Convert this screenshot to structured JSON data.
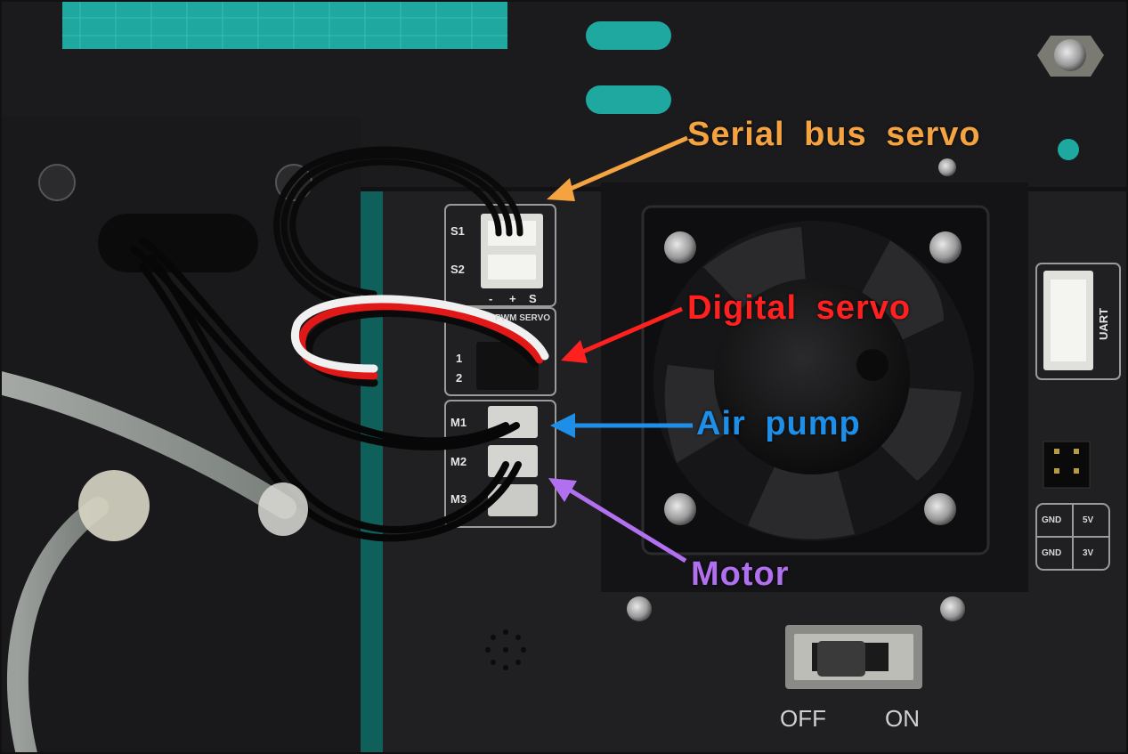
{
  "callouts": {
    "serial_bus_servo": {
      "text": "Serial bus servo",
      "color": "#F5A340"
    },
    "digital_servo": {
      "text": "Digital servo",
      "color": "#FF2020"
    },
    "air_pump": {
      "text": "Air pump",
      "color": "#1E8FE8"
    },
    "motor": {
      "text": "Motor",
      "color": "#B070F0"
    }
  },
  "board_labels": {
    "s1": "S1",
    "s2": "S2",
    "pin_minus": "-",
    "pin_plus": "+",
    "pin_s": "S",
    "pwm_servo": "PWM SERVO",
    "pwm_1": "1",
    "pwm_2": "2",
    "m1": "M1",
    "m2": "M2",
    "m3": "M3",
    "uart": "UART",
    "gnd_1": "GND",
    "v5": "5V",
    "gnd_2": "GND",
    "v3": "3V"
  },
  "switch": {
    "off": "OFF",
    "on": "ON"
  },
  "colors": {
    "background_board": "#1A1A1C",
    "teal_mat": "#1FA8A0",
    "wire_black": "#0A0A0A",
    "wire_red": "#E01818",
    "wire_white": "#F0F0F0"
  }
}
